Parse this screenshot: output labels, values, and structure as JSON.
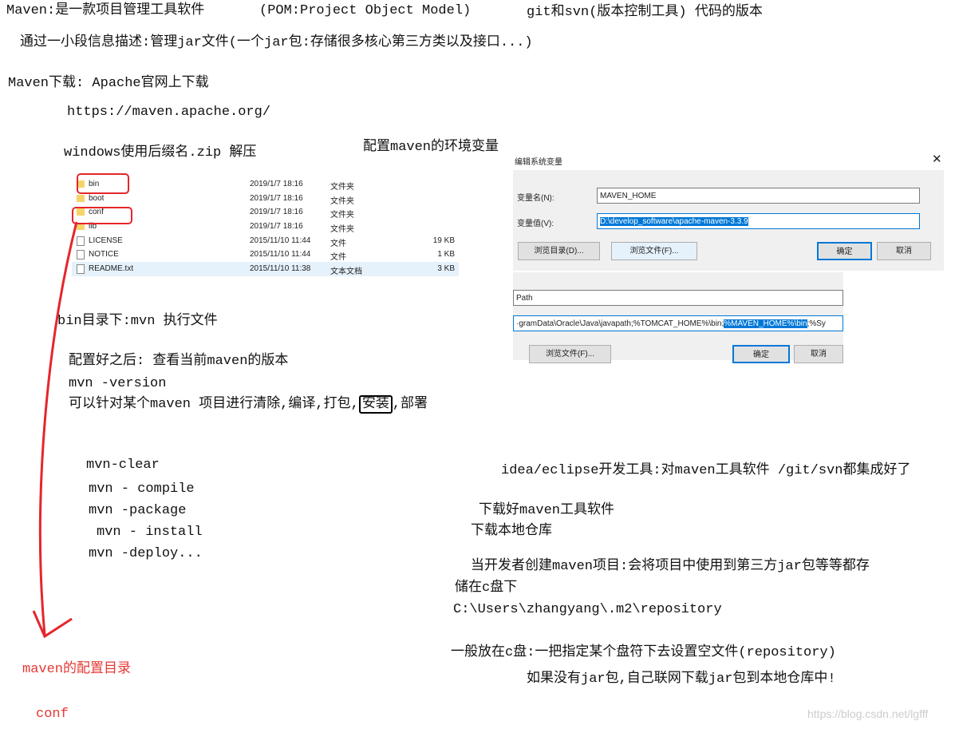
{
  "notes": {
    "l1": "Maven:是一款项目管理工具软件",
    "l1b": "(POM:Project Object Model)",
    "l1c": "git和svn(版本控制工具) 代码的版本",
    "l2": "通过一小段信息描述:管理jar文件(一个jar包:存储很多核心第三方类以及接口...)",
    "l3": "Maven下载: Apache官网上下载",
    "l4": "https://maven.apache.org/",
    "l5": "windows使用后缀名.zip 解压",
    "l5b": "配置maven的环境变量",
    "l6": "bin目录下:mvn  执行文件",
    "l7": "配置好之后: 查看当前maven的版本",
    "l8": "mvn -version",
    "l9a": "可以针对某个maven 项目进行清除,编译,打包,",
    "l9b": "安装",
    "l9c": ",部署",
    "cmds": [
      "mvn-clear",
      "mvn - compile",
      "mvn -package",
      "mvn - install",
      "mvn -deploy..."
    ],
    "r1": "idea/eclipse开发工具:对maven工具软件 /git/svn都集成好了",
    "r2": "下载好maven工具软件",
    "r3": "下载本地仓库",
    "r4": "当开发者创建maven项目:会将项目中使用到第三方jar包等等都存",
    "r5": "储在c盘下",
    "r6": "C:\\Users\\zhangyang\\.m2\\repository",
    "r7": "一般放在c盘:一把指定某个盘符下去设置空文件(repository)",
    "r8": "如果没有jar包,自己联网下载jar包到本地仓库中!",
    "red1": "maven的配置目录",
    "red2": "conf",
    "watermark": "https://blog.csdn.net/lgfff"
  },
  "files": [
    {
      "name": "bin",
      "date": "2019/1/7 18:16",
      "type": "文件夹",
      "size": "",
      "icon": "folder-icon"
    },
    {
      "name": "boot",
      "date": "2019/1/7 18:16",
      "type": "文件夹",
      "size": "",
      "icon": "folder-icon"
    },
    {
      "name": "conf",
      "date": "2019/1/7 18:16",
      "type": "文件夹",
      "size": "",
      "icon": "folder-icon"
    },
    {
      "name": "lib",
      "date": "2019/1/7 18:16",
      "type": "文件夹",
      "size": "",
      "icon": "folder-icon"
    },
    {
      "name": "LICENSE",
      "date": "2015/11/10 11:44",
      "type": "文件",
      "size": "19 KB",
      "icon": "file-icon"
    },
    {
      "name": "NOTICE",
      "date": "2015/11/10 11:44",
      "type": "文件",
      "size": "1 KB",
      "icon": "file-icon"
    },
    {
      "name": "README.txt",
      "date": "2015/11/10 11:38",
      "type": "文本文档",
      "size": "3 KB",
      "icon": "text-file-icon"
    }
  ],
  "dialog": {
    "title": "编辑系统变量",
    "name_label": "变量名(N):",
    "name_value": "MAVEN_HOME",
    "value_label": "变量值(V):",
    "value_value": "D:\\develop_software\\apache-maven-3.3.9",
    "browse_dir": "浏览目录(D)...",
    "browse_file": "浏览文件(F)...",
    "ok": "确定",
    "cancel": "取消"
  },
  "path_dialog": {
    "name_value": "Path",
    "value_pre": "·gramData\\Oracle\\Java\\javapath;%TOMCAT_HOME%\\bin;",
    "value_sel": "%MAVEN_HOME%\\bin",
    "value_post": ";%Sy",
    "browse_file": "浏览文件(F)...",
    "ok": "确定",
    "cancel": "取消"
  },
  "colors": {
    "annotation_red": "#e5262b",
    "selection": "#0078d7"
  }
}
